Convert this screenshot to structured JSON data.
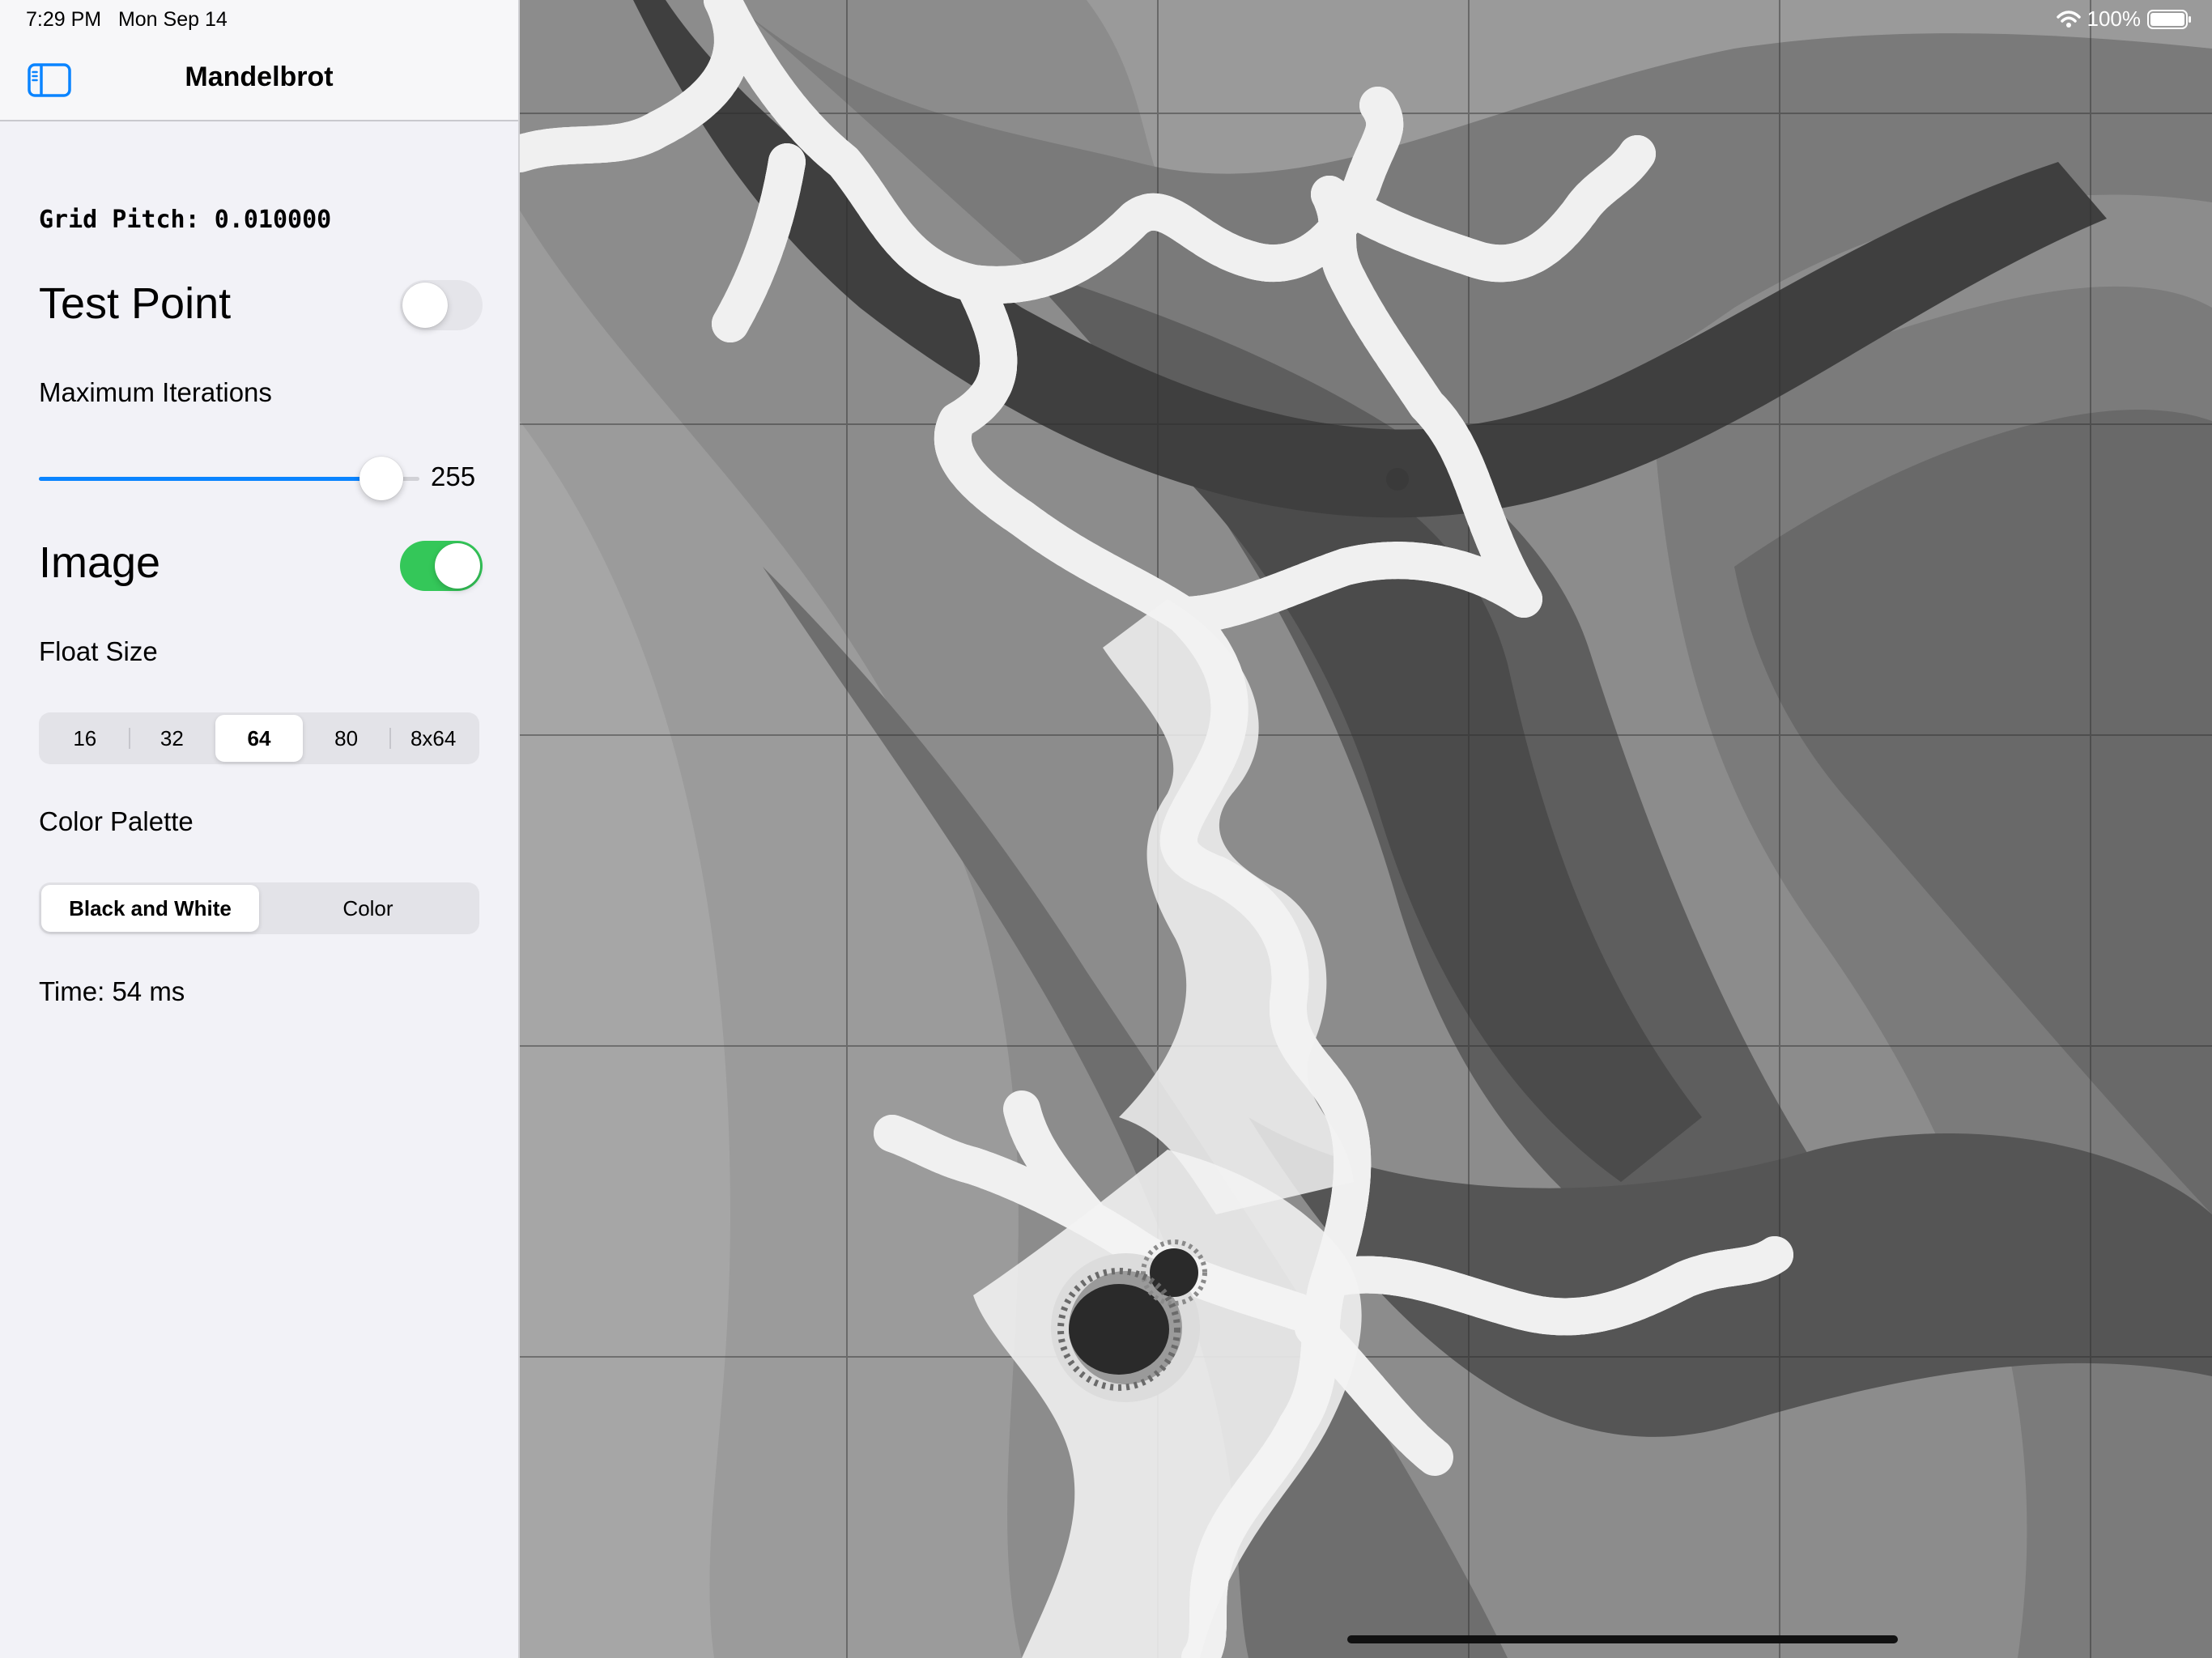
{
  "status_bar": {
    "time": "7:29 PM",
    "date": "Mon Sep 14",
    "battery_percent": "100%",
    "battery_level": 1.0,
    "wifi_icon": "wifi-icon"
  },
  "nav": {
    "title": "Mandelbrot",
    "sidebar_icon": "sidebar-left-icon"
  },
  "controls": {
    "grid_pitch": "Grid Pitch: 0.010000",
    "test_point": {
      "label": "Test Point",
      "on": false
    },
    "max_iterations": {
      "label": "Maximum Iterations",
      "value": 255,
      "value_text": "255",
      "fraction": 0.9
    },
    "image": {
      "label": "Image",
      "on": true
    },
    "float_size": {
      "label": "Float Size",
      "options": [
        "16",
        "32",
        "64",
        "80",
        "8x64"
      ],
      "selected": "64"
    },
    "color_palette": {
      "label": "Color Palette",
      "options": [
        "Black and White",
        "Color"
      ],
      "selected": "Black and White"
    },
    "time": "Time: 54 ms"
  },
  "colors": {
    "accent": "#0a84ff",
    "toggle_on": "#34c759",
    "toggle_off": "#e5e5ea",
    "sidebar_bg": "#f2f2f7"
  }
}
